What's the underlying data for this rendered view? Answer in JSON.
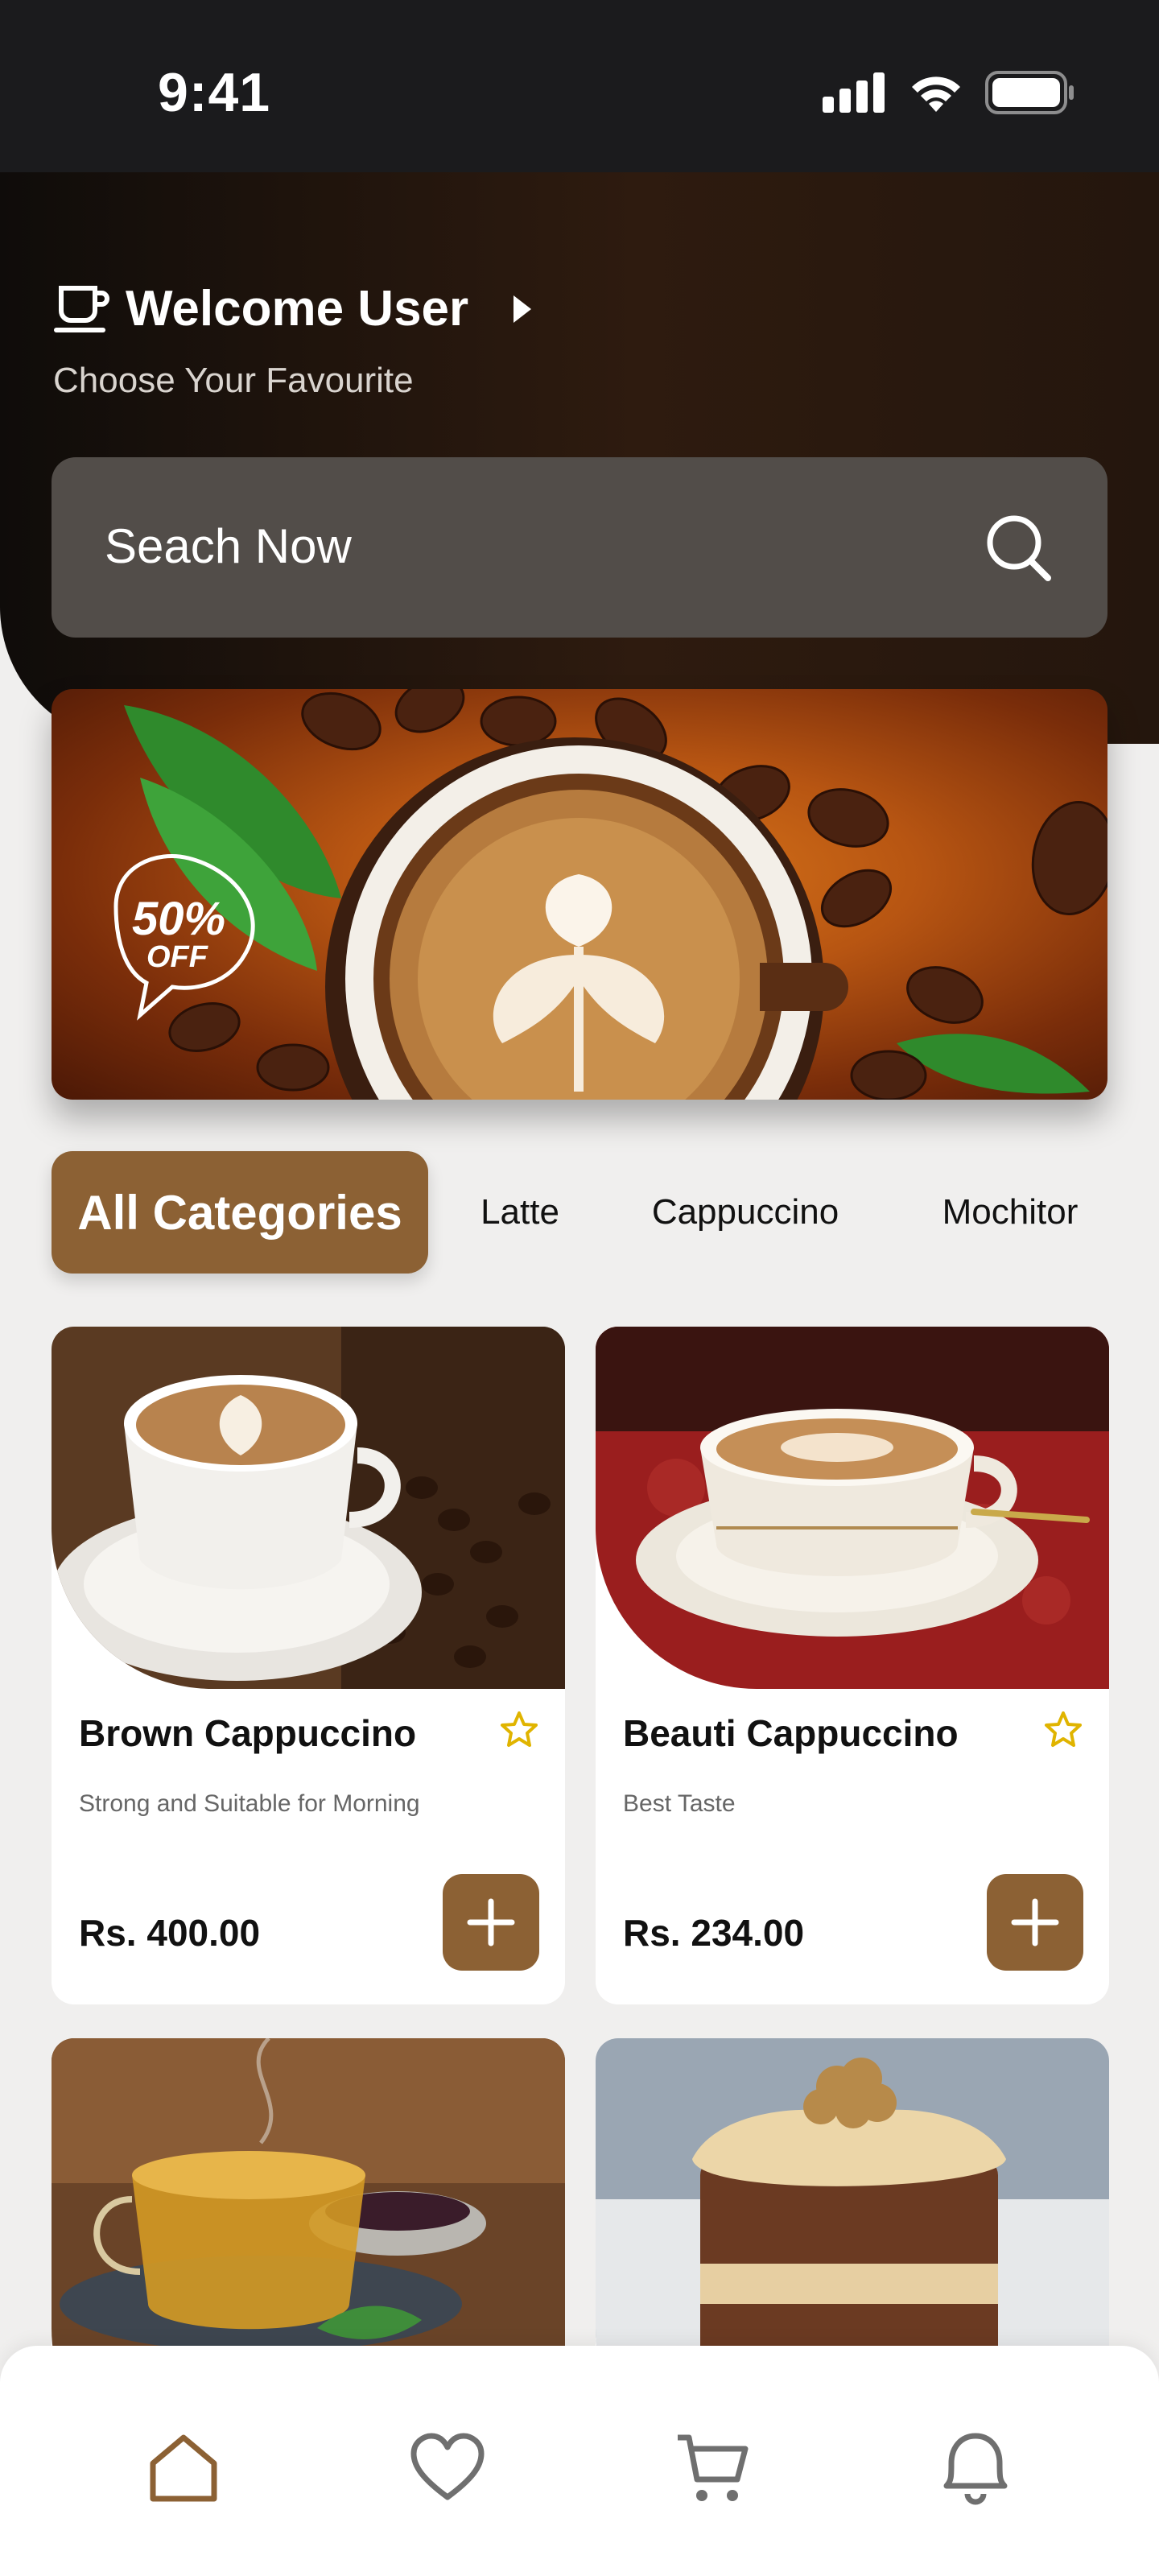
{
  "status_bar": {
    "time": "9:41"
  },
  "header": {
    "welcome_title": "Welcome User",
    "welcome_subtitle": "Choose Your Favourite"
  },
  "search": {
    "placeholder": "Seach Now"
  },
  "banner": {
    "badge_text": "50%",
    "badge_subtext": "OFF"
  },
  "categories": [
    {
      "label": "All Categories",
      "active": true
    },
    {
      "label": "Latte"
    },
    {
      "label": "Cappuccino"
    },
    {
      "label": "Mochitor"
    }
  ],
  "products": [
    {
      "name": "Brown Cappuccino",
      "description": "Strong and Suitable for Morning",
      "price": "Rs. 400.00"
    },
    {
      "name": "Beauti Cappuccino",
      "description": "Best Taste",
      "price": "Rs. 234.00"
    },
    {
      "name": "",
      "description": "",
      "price": ""
    },
    {
      "name": "",
      "description": "",
      "price": ""
    }
  ],
  "bottom_nav": [
    "home-icon",
    "heart-icon",
    "cart-icon",
    "bell-icon"
  ],
  "colors": {
    "accent": "#8c6134",
    "dark": "#1b1b1d",
    "star": "#e0b400"
  }
}
